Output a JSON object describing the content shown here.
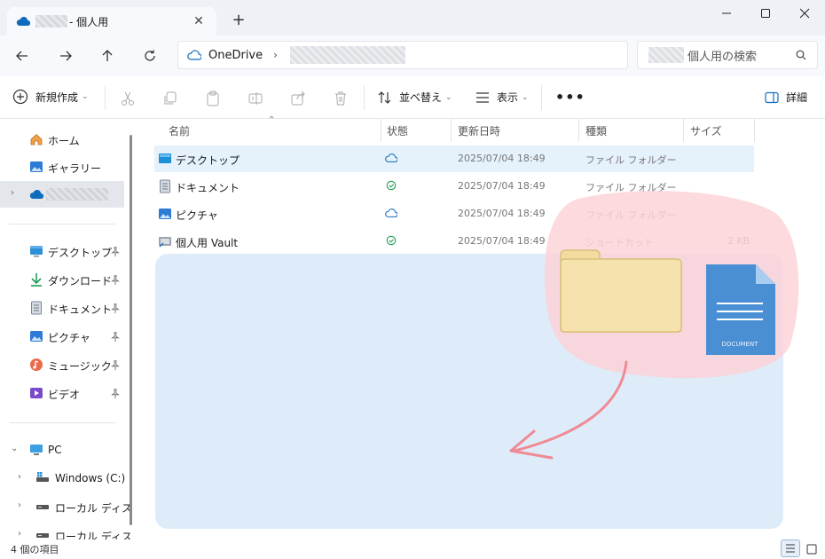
{
  "window": {
    "tab_title": "- 個人用",
    "tab_close": "✕",
    "new_tab": "+"
  },
  "address": {
    "root": "OneDrive",
    "separator": "›",
    "search_placeholder": "個人用の検索"
  },
  "toolbar": {
    "new_label": "新規作成",
    "sort_label": "並べ替え",
    "view_label": "表示",
    "more_label": "•••",
    "details_label": "詳細",
    "chevron": "⌄"
  },
  "sidebar": {
    "home": "ホーム",
    "gallery": "ギャラリー",
    "quick": [
      {
        "label": "デスクトップ",
        "icon": "desktop-icon"
      },
      {
        "label": "ダウンロード",
        "icon": "download-icon"
      },
      {
        "label": "ドキュメント",
        "icon": "document-icon"
      },
      {
        "label": "ピクチャ",
        "icon": "pictures-icon"
      },
      {
        "label": "ミュージック",
        "icon": "music-icon"
      },
      {
        "label": "ビデオ",
        "icon": "video-icon"
      }
    ],
    "pc": "PC",
    "drives": [
      "Windows (C:)",
      "ローカル ディスク",
      "ローカル ディスク"
    ]
  },
  "columns": {
    "name": "名前",
    "status": "状態",
    "modified": "更新日時",
    "type": "種類",
    "size": "サイズ"
  },
  "files": [
    {
      "name": "デスクトップ",
      "status": "cloud",
      "modified": "2025/07/04 18:49",
      "type": "ファイル フォルダー",
      "size": ""
    },
    {
      "name": "ドキュメント",
      "status": "synced",
      "modified": "2025/07/04 18:49",
      "type": "ファイル フォルダー",
      "size": ""
    },
    {
      "name": "ピクチャ",
      "status": "cloud",
      "modified": "2025/07/04 18:49",
      "type": "ファイル フォルダー",
      "size": ""
    },
    {
      "name": "個人用 Vault",
      "status": "synced",
      "modified": "2025/07/04 18:49",
      "type": "ショートカット",
      "size": "2 KB"
    }
  ],
  "overlay": {
    "doc_label": "DOCUMENT"
  },
  "statusbar": {
    "count": "4 個の項目"
  },
  "colors": {
    "accent": "#0f6cbd",
    "dropzone": "#deecf9",
    "blob": "#fbd4d8",
    "arrow": "#f08a94",
    "folder": "#f3dca0",
    "doc": "#4a8fd3"
  }
}
